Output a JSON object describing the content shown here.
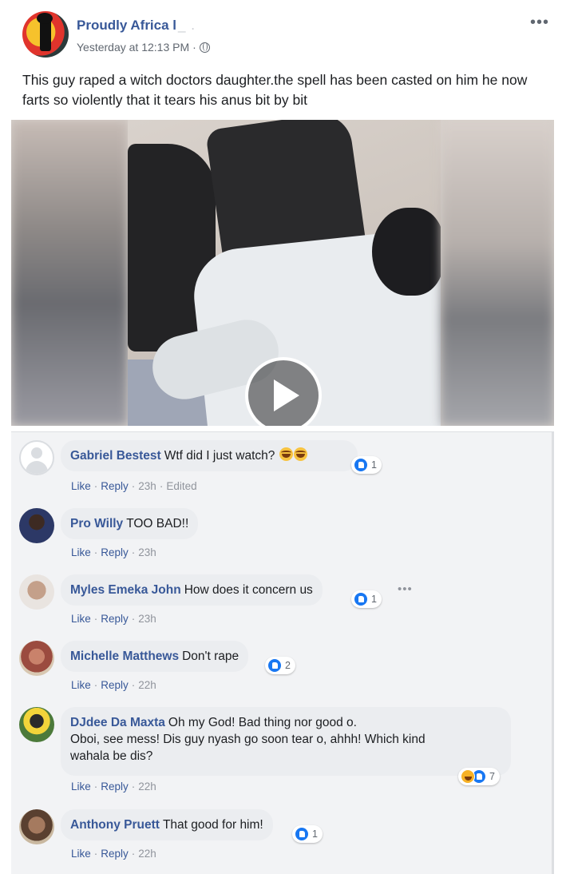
{
  "post": {
    "page_name": "Proudly Africa l",
    "page_name_trail": "_ .",
    "timestamp": "Yesterday at 12:13 PM",
    "separator": "·",
    "privacy_icon": "globe-icon",
    "more_label": "•••",
    "text": "This guy raped a witch doctors daughter.the spell has been casted on him he now farts so violently that it tears his anus bit by bit"
  },
  "video": {
    "play_icon": "play-icon"
  },
  "comment_ui": {
    "like": "Like",
    "reply": "Reply",
    "dot": "·",
    "edited": "Edited",
    "more": "•••"
  },
  "comments": [
    {
      "author": "Gabriel Bestest",
      "text": "Wtf did I just watch?",
      "time": "23h",
      "edited": true,
      "reactions": "1",
      "reaction_icons": [
        "like"
      ]
    },
    {
      "author": "Pro Willy",
      "text": "TOO BAD!!",
      "time": "23h",
      "edited": false,
      "reactions": "",
      "reaction_icons": []
    },
    {
      "author": "Myles Emeka John",
      "text": "How does it concern us",
      "time": "23h",
      "edited": false,
      "reactions": "1",
      "reaction_icons": [
        "like"
      ]
    },
    {
      "author": "Michelle Matthews",
      "text": "Don't rape",
      "time": "22h",
      "edited": false,
      "reactions": "2",
      "reaction_icons": [
        "like"
      ]
    },
    {
      "author": "DJdee Da Maxta",
      "text": "Oh my God! Bad thing nor good o.",
      "text2": "Oboi, see mess! Dis guy nyash go soon tear o, ahhh! Which kind",
      "text3": "wahala be dis?",
      "time": "22h",
      "edited": false,
      "reactions": "7",
      "reaction_icons": [
        "haha",
        "like"
      ]
    },
    {
      "author": "Anthony Pruett",
      "text": "That good for him!",
      "time": "22h",
      "edited": false,
      "reactions": "1",
      "reaction_icons": [
        "like"
      ]
    }
  ],
  "colors": {
    "link": "#385898",
    "meta": "#606770",
    "bubble": "#ebedf0",
    "comments_bg": "#f2f3f5",
    "like_blue": "#1877f2",
    "haha_yellow": "#f7b125"
  }
}
